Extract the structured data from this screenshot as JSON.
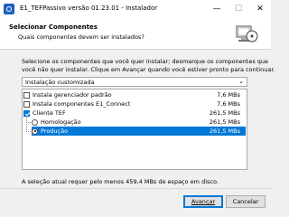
{
  "window": {
    "title": "E1_TEFPassivo versão 01.23.01 - Instalador",
    "minimize_glyph": "—",
    "maximize_glyph": "☐",
    "close_glyph": "✕"
  },
  "header": {
    "title": "Selecionar Componentes",
    "subtitle": "Quais componentes devem ser instalados?",
    "icon": "computer-cd-icon"
  },
  "description": {
    "line1": "Selecione os componentes que você quer instalar; desmarque os componentes que",
    "line2": "você não quer instalar. Clique em Avançar quando você estiver pronto para continuar."
  },
  "install_type": {
    "selected": "Instalação customizada",
    "arrow": "⌄"
  },
  "components": [
    {
      "label": "Instala gerenciador padrão",
      "size": "7,6 MBs",
      "control": "checkbox",
      "checked": false
    },
    {
      "label": "Instala componentes E1_Connect",
      "size": "7,6 MBs",
      "control": "checkbox",
      "checked": false
    },
    {
      "label": "Cliente TEF",
      "size": "261,5 MBs",
      "control": "checkbox",
      "checked": true
    },
    {
      "label": "Homologação",
      "size": "261,5 MBs",
      "control": "radio",
      "checked": false
    },
    {
      "label": "Produção",
      "size": "261,5 MBs",
      "control": "radio",
      "checked": true,
      "selected": true
    }
  ],
  "footer": {
    "space_required": "A seleção atual requer pelo menos 459,4 MBs de espaço em disco."
  },
  "buttons": {
    "next": "Avançar",
    "cancel": "Cancelar"
  },
  "colors": {
    "selection": "#0078d7",
    "background": "#f0f0f0"
  }
}
